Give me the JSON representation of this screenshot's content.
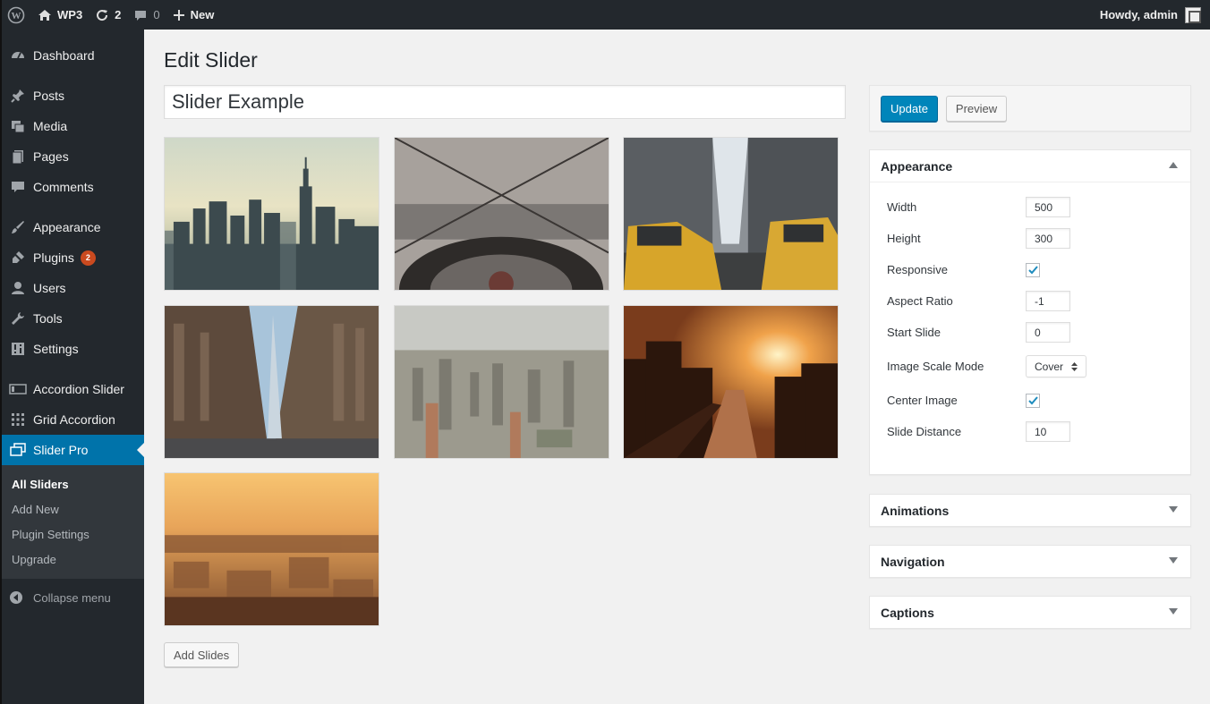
{
  "adminbar": {
    "site_name": "WP3",
    "updates_count": "2",
    "comments_count": "0",
    "new_label": "New",
    "greeting": "Howdy, admin"
  },
  "sidebar": {
    "items": [
      {
        "label": "Dashboard",
        "icon": "dashboard-icon"
      },
      {
        "label": "Posts",
        "icon": "pin-icon"
      },
      {
        "label": "Media",
        "icon": "media-icon"
      },
      {
        "label": "Pages",
        "icon": "pages-icon"
      },
      {
        "label": "Comments",
        "icon": "comment-icon"
      },
      {
        "label": "Appearance",
        "icon": "brush-icon"
      },
      {
        "label": "Plugins",
        "icon": "plugin-icon",
        "badge": "2"
      },
      {
        "label": "Users",
        "icon": "user-icon"
      },
      {
        "label": "Tools",
        "icon": "wrench-icon"
      },
      {
        "label": "Settings",
        "icon": "settings-icon"
      },
      {
        "label": "Accordion Slider",
        "icon": "accordion-icon"
      },
      {
        "label": "Grid Accordion",
        "icon": "grid-icon"
      },
      {
        "label": "Slider Pro",
        "icon": "slider-icon"
      }
    ],
    "submenu": [
      "All Sliders",
      "Add New",
      "Plugin Settings",
      "Upgrade"
    ],
    "collapse_label": "Collapse menu"
  },
  "main": {
    "page_title": "Edit Slider",
    "slider_name": "Slider Example",
    "add_slides_label": "Add Slides"
  },
  "publish": {
    "update_label": "Update",
    "preview_label": "Preview"
  },
  "appearance": {
    "title": "Appearance",
    "fields": [
      {
        "label": "Width",
        "value": "500"
      },
      {
        "label": "Height",
        "value": "300"
      },
      {
        "label": "Responsive"
      },
      {
        "label": "Aspect Ratio",
        "value": "-1"
      },
      {
        "label": "Start Slide",
        "value": "0"
      },
      {
        "label": "Image Scale Mode",
        "value": "Cover"
      },
      {
        "label": "Center Image"
      },
      {
        "label": "Slide Distance",
        "value": "10"
      }
    ]
  },
  "panels": {
    "animations": "Animations",
    "navigation": "Navigation",
    "captions": "Captions"
  },
  "colors": {
    "admin_dark": "#23282d",
    "accent": "#0073aa",
    "primary_button": "#0085ba",
    "badge": "#ca4a1f"
  }
}
